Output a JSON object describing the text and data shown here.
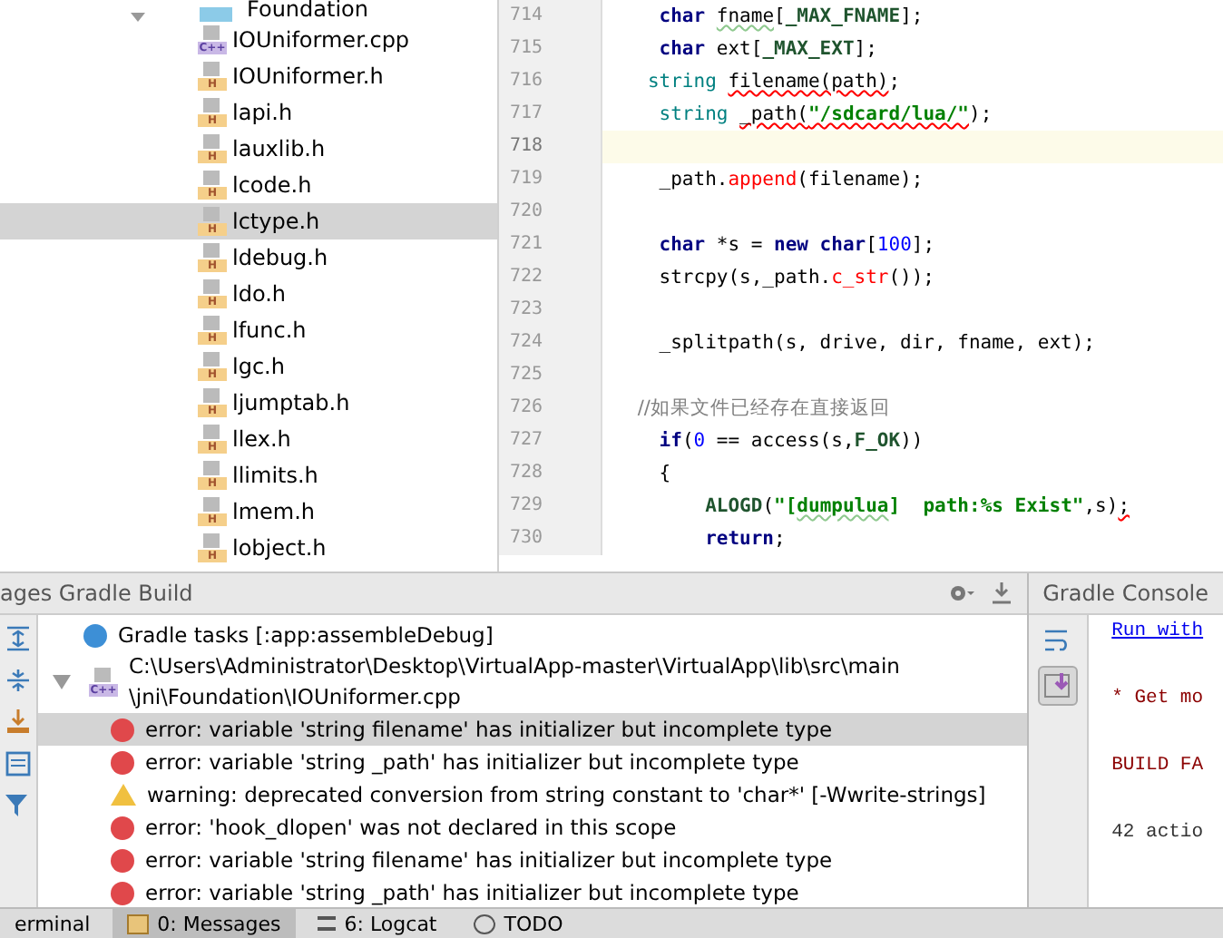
{
  "project_tree": {
    "folder": {
      "label": "Foundation",
      "expanded": true
    },
    "items": [
      {
        "label": "IOUniformer.cpp",
        "kind": "cpp",
        "badge": "C++",
        "selected": false
      },
      {
        "label": "IOUniformer.h",
        "kind": "h",
        "badge": "H",
        "selected": false
      },
      {
        "label": "lapi.h",
        "kind": "h",
        "badge": "H",
        "selected": false
      },
      {
        "label": "lauxlib.h",
        "kind": "h",
        "badge": "H",
        "selected": false
      },
      {
        "label": "lcode.h",
        "kind": "h",
        "badge": "H",
        "selected": false
      },
      {
        "label": "lctype.h",
        "kind": "h",
        "badge": "H",
        "selected": true
      },
      {
        "label": "ldebug.h",
        "kind": "h",
        "badge": "H",
        "selected": false
      },
      {
        "label": "ldo.h",
        "kind": "h",
        "badge": "H",
        "selected": false
      },
      {
        "label": "lfunc.h",
        "kind": "h",
        "badge": "H",
        "selected": false
      },
      {
        "label": "lgc.h",
        "kind": "h",
        "badge": "H",
        "selected": false
      },
      {
        "label": "ljumptab.h",
        "kind": "h",
        "badge": "H",
        "selected": false
      },
      {
        "label": "llex.h",
        "kind": "h",
        "badge": "H",
        "selected": false
      },
      {
        "label": "llimits.h",
        "kind": "h",
        "badge": "H",
        "selected": false
      },
      {
        "label": "lmem.h",
        "kind": "h",
        "badge": "H",
        "selected": false
      },
      {
        "label": "lobject.h",
        "kind": "h",
        "badge": "H",
        "selected": false
      }
    ]
  },
  "editor": {
    "lines": [
      {
        "number": "714",
        "current": false,
        "segments": [
          {
            "text": "    char ",
            "kind": "keyword"
          },
          {
            "text": "fname",
            "kind": "plain",
            "typo": true
          },
          {
            "text": "[",
            "kind": "plain"
          },
          {
            "text": "_MAX_FNAME",
            "kind": "macro"
          },
          {
            "text": "];",
            "kind": "plain"
          }
        ]
      },
      {
        "number": "715",
        "current": false,
        "segments": [
          {
            "text": "    char",
            "kind": "keyword"
          },
          {
            "text": " ext[",
            "kind": "plain"
          },
          {
            "text": "_MAX_EXT",
            "kind": "macro"
          },
          {
            "text": "];",
            "kind": "plain"
          }
        ]
      },
      {
        "number": "716",
        "current": false,
        "segments": [
          {
            "text": "   string ",
            "kind": "type"
          },
          {
            "text": "filename(path)",
            "kind": "plain",
            "error": true
          },
          {
            "text": ";",
            "kind": "plain"
          }
        ]
      },
      {
        "number": "717",
        "current": false,
        "segments": [
          {
            "text": "    string ",
            "kind": "type"
          },
          {
            "text": "_path(",
            "kind": "plain",
            "error": true
          },
          {
            "text": "\"/sdcard/lua/\"",
            "kind": "string",
            "error": true
          },
          {
            "text": ");",
            "kind": "plain"
          }
        ]
      },
      {
        "number": "718",
        "current": true
      },
      {
        "number": "719",
        "current": false,
        "segments": [
          {
            "text": "    _path.",
            "kind": "plain"
          },
          {
            "text": "append",
            "kind": "call"
          },
          {
            "text": "(filename);",
            "kind": "plain"
          }
        ]
      },
      {
        "number": "720",
        "current": false
      },
      {
        "number": "721",
        "current": false,
        "segments": [
          {
            "text": "    char",
            "kind": "keyword"
          },
          {
            "text": " *s = ",
            "kind": "plain"
          },
          {
            "text": "new char",
            "kind": "keyword"
          },
          {
            "text": "[",
            "kind": "plain"
          },
          {
            "text": "100",
            "kind": "number"
          },
          {
            "text": "];",
            "kind": "plain"
          }
        ]
      },
      {
        "number": "722",
        "current": false,
        "segments": [
          {
            "text": "    strcpy(s,_path.",
            "kind": "plain"
          },
          {
            "text": "c_str",
            "kind": "call"
          },
          {
            "text": "());",
            "kind": "plain"
          }
        ]
      },
      {
        "number": "723",
        "current": false
      },
      {
        "number": "724",
        "current": false,
        "segments": [
          {
            "text": "    _splitpath(s, drive, dir, fname, ext);",
            "kind": "plain"
          }
        ]
      },
      {
        "number": "725",
        "current": false
      },
      {
        "number": "726",
        "current": false,
        "segments": [
          {
            "text": "    //如果文件已经存在直接返回",
            "kind": "comment"
          }
        ]
      },
      {
        "number": "727",
        "current": false,
        "segments": [
          {
            "text": "    if",
            "kind": "keyword"
          },
          {
            "text": "(",
            "kind": "plain"
          },
          {
            "text": "0",
            "kind": "number"
          },
          {
            "text": " == access(s,",
            "kind": "plain"
          },
          {
            "text": "F_OK",
            "kind": "macro"
          },
          {
            "text": "))",
            "kind": "plain"
          }
        ]
      },
      {
        "number": "728",
        "current": false,
        "segments": [
          {
            "text": "    {",
            "kind": "plain"
          }
        ]
      },
      {
        "number": "729",
        "current": false,
        "segments": [
          {
            "text": "        ALOGD",
            "kind": "macro"
          },
          {
            "text": "(",
            "kind": "plain"
          },
          {
            "text": "\"[",
            "kind": "string"
          },
          {
            "text": "dumpulua",
            "kind": "string",
            "typo": true
          },
          {
            "text": "]  path:%s Exist\"",
            "kind": "string"
          },
          {
            "text": ",s)",
            "kind": "plain"
          },
          {
            "text": ";",
            "kind": "plain",
            "error": true
          }
        ]
      },
      {
        "number": "730",
        "current": false,
        "segments": [
          {
            "text": "        return",
            "kind": "keyword"
          },
          {
            "text": ";",
            "kind": "plain"
          }
        ]
      }
    ]
  },
  "messages_panel": {
    "title": "ages Gradle Build",
    "rows": [
      {
        "kind": "info",
        "text": "Gradle tasks [:app:assembleDebug]",
        "selected": false
      },
      {
        "kind": "file",
        "text": "C:\\Users\\Administrator\\Desktop\\VirtualApp-master\\VirtualApp\\lib\\src\\main\\jni\\Foundation\\IOUniformer.cpp",
        "badge": "C++",
        "expanded": true,
        "selected": false
      },
      {
        "kind": "error",
        "text": "error: variable 'string filename' has initializer but incomplete type",
        "selected": true
      },
      {
        "kind": "error",
        "text": "error: variable 'string _path' has initializer but incomplete type",
        "selected": false
      },
      {
        "kind": "warning",
        "text": "warning: deprecated conversion from string constant to 'char*' [-Wwrite-strings]",
        "selected": false
      },
      {
        "kind": "error",
        "text": "error: 'hook_dlopen' was not declared in this scope",
        "selected": false
      },
      {
        "kind": "error",
        "text": "error: variable 'string filename' has initializer but incomplete type",
        "selected": false
      },
      {
        "kind": "error",
        "text": "error: variable 'string _path' has initializer but incomplete type",
        "selected": false
      }
    ]
  },
  "gradle_console": {
    "title": "Gradle Console",
    "lines": [
      {
        "text": "Run with",
        "kind": "link"
      },
      {
        "text": "* Get mo",
        "kind": "error"
      },
      {
        "text": "BUILD FA",
        "kind": "error"
      },
      {
        "text": "42 actio",
        "kind": "plain"
      }
    ]
  },
  "bottom_tabs": [
    {
      "label": "erminal",
      "selected": false,
      "kind": "terminal"
    },
    {
      "label": "0: Messages",
      "selected": true,
      "kind": "messages"
    },
    {
      "label": "6: Logcat",
      "selected": false,
      "kind": "logcat"
    },
    {
      "label": "TODO",
      "selected": false,
      "kind": "todo"
    }
  ]
}
